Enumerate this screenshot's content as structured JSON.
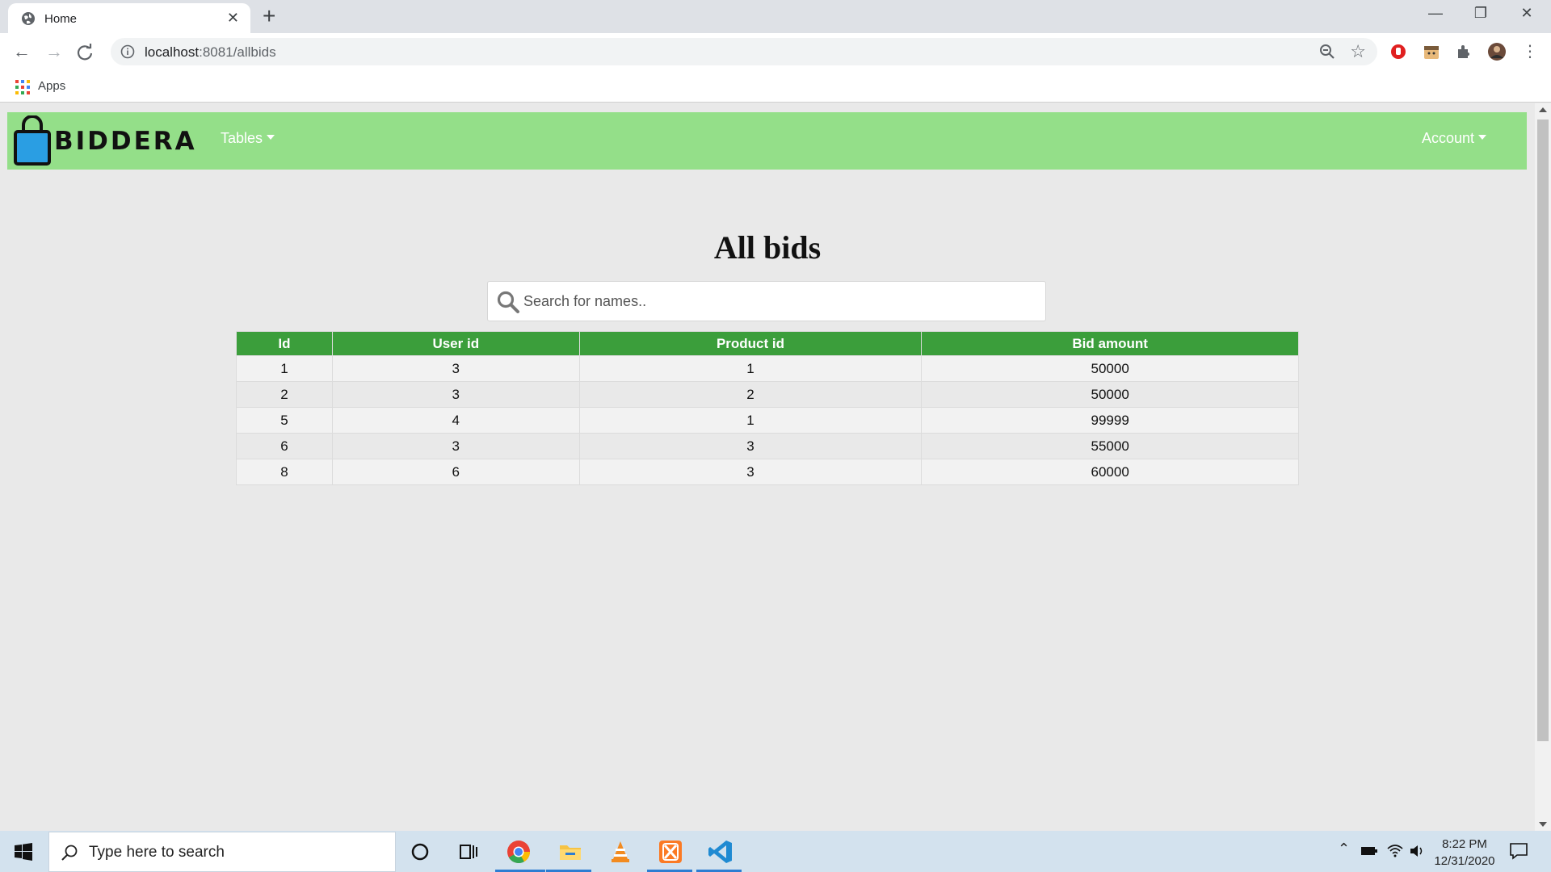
{
  "browser": {
    "tab_title": "Home",
    "tab_close": "✕",
    "new_tab": "+",
    "url_host": "localhost",
    "url_rest": ":8081/allbids",
    "bookmark_apps": "Apps",
    "window_minimize": "—",
    "window_restore": "❐",
    "window_close": "✕"
  },
  "site": {
    "logo_text": "BIDDERA",
    "nav_tables": "Tables",
    "nav_account": "Account",
    "navbar_color": "#94df89",
    "header_color": "#3b9e3b"
  },
  "page": {
    "title": "All bids",
    "search_placeholder": "Search for names.."
  },
  "table": {
    "headers": [
      "Id",
      "User id",
      "Product id",
      "Bid amount"
    ],
    "rows": [
      [
        "1",
        "3",
        "1",
        "50000"
      ],
      [
        "2",
        "3",
        "2",
        "50000"
      ],
      [
        "5",
        "4",
        "1",
        "99999"
      ],
      [
        "6",
        "3",
        "3",
        "55000"
      ],
      [
        "8",
        "6",
        "3",
        "60000"
      ]
    ]
  },
  "taskbar": {
    "search_placeholder": "Type here to search",
    "time": "8:22 PM",
    "date": "12/31/2020"
  }
}
